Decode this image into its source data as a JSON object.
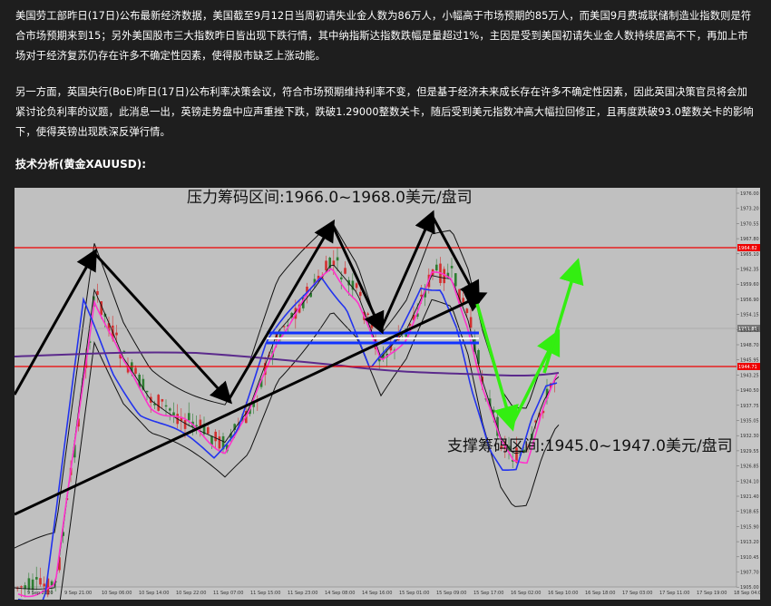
{
  "article": {
    "paragraph1": "美国劳工部昨日(17日)公布最新经济数据，美国截至9月12日当周初请失业金人数为86万人，小幅高于市场预期的85万人，而美国9月费城联储制造业指数则是符合市场预期来到15；另外美国股市三大指数昨日皆出现下跌行情，其中纳指斯达指数跌幅是量超过1%，主因是受到美国初请失业金人数持续居高不下，再加上市场对于经济复苏仍存在许多不确定性因素，使得股市缺乏上涨动能。",
    "paragraph2": "另一方面，英国央行(BoE)昨日(17日)公布利率决策会议，符合市场预期维持利率不变，但是基于经济未来成长存在许多不确定性因素，因此英国决策官员将会加紧讨论负利率的议题，此消息一出，英镑走势盘中应声重挫下跌，跌破1.29000整数关卡，随后受到美元指数冲高大幅拉回修正，且再度跌破93.0整数关卡的影响下，使得英镑出现跌深反弹行情。",
    "heading": "技术分析(黄金XAUUSD):"
  },
  "chart_data": {
    "type": "line",
    "symbol": "XAUUSD",
    "annotations": {
      "resistance": "压力筹码区间:1966.0~1968.0美元/盘司",
      "support": "支撑筹码区间:1945.0~1947.0美元/盘司"
    },
    "y_ticks": [
      "1976.00",
      "1973.20",
      "1970.55",
      "1967.80",
      "1965.10",
      "1962.35",
      "1959.60",
      "1956.90",
      "1954.15",
      "1951.45",
      "1948.70",
      "1945.95",
      "1943.25",
      "1940.50",
      "1937.75",
      "1935.05",
      "1932.30",
      "1929.55",
      "1926.85",
      "1924.10",
      "1921.40",
      "1918.65",
      "1915.90",
      "1913.20",
      "1910.45",
      "1907.70",
      "1905.00"
    ],
    "x_ticks": [
      "9 Sep 2020",
      "9 Sep 21:00",
      "10 Sep 06:00",
      "10 Sep 14:00",
      "10 Sep 22:00",
      "11 Sep 07:00",
      "11 Sep 15:00",
      "11 Sep 23:00",
      "14 Sep 08:00",
      "14 Sep 16:00",
      "15 Sep 01:00",
      "15 Sep 09:00",
      "15 Sep 17:00",
      "16 Sep 02:00",
      "16 Sep 10:00",
      "16 Sep 18:00",
      "17 Sep 03:00",
      "17 Sep 11:00",
      "17 Sep 19:00",
      "18 Sep 04:00"
    ],
    "price_badges": [
      "1964.82",
      "1951.85",
      "1944.71"
    ],
    "ylim": [
      1905,
      1976
    ]
  }
}
